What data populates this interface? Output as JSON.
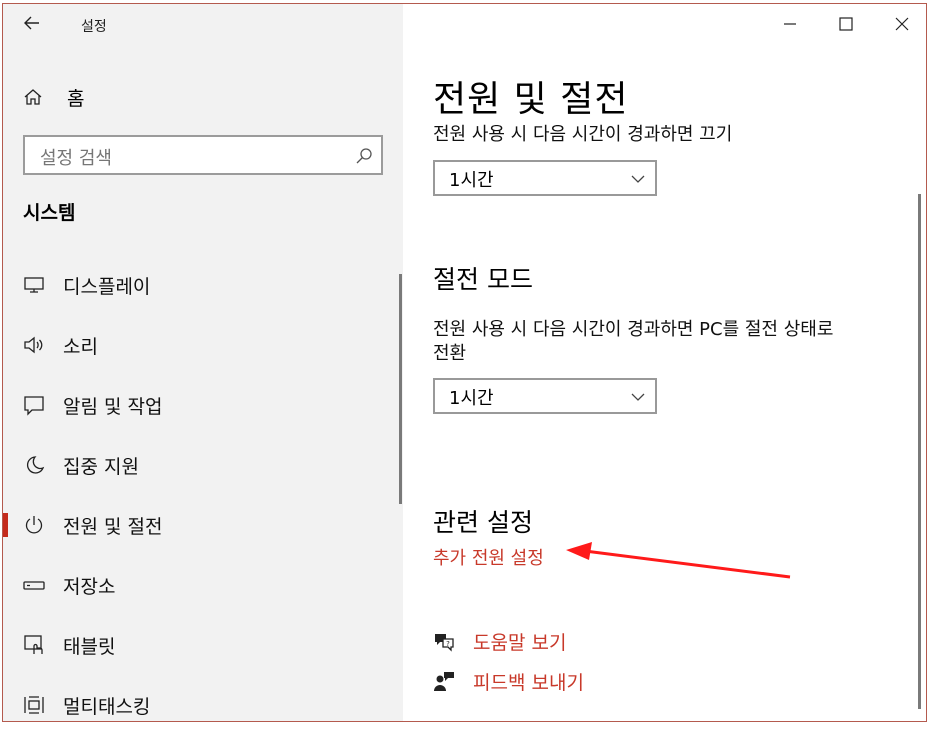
{
  "window": {
    "title": "설정",
    "back_icon": "back-arrow-icon",
    "controls": [
      "minimize-icon",
      "maximize-icon",
      "close-icon"
    ]
  },
  "sidebar": {
    "home_label": "홈",
    "search_placeholder": "설정 검색",
    "section_title": "시스템",
    "items": [
      {
        "label": "디스플레이",
        "icon": "display-icon"
      },
      {
        "label": "소리",
        "icon": "speaker-icon"
      },
      {
        "label": "알림 및 작업",
        "icon": "notification-icon"
      },
      {
        "label": "집중 지원",
        "icon": "moon-icon"
      },
      {
        "label": "전원 및 절전",
        "icon": "power-icon",
        "active": true
      },
      {
        "label": "저장소",
        "icon": "storage-icon"
      },
      {
        "label": "태블릿",
        "icon": "tablet-icon"
      },
      {
        "label": "멀티태스킹",
        "icon": "multitasking-icon"
      }
    ]
  },
  "main": {
    "title": "전원 및 절전",
    "screen_label": "전원 사용 시 다음 시간이 경과하면 끄기",
    "screen_value": "1시간",
    "sleep_title": "절전 모드",
    "sleep_label_line1": "전원 사용 시 다음 시간이 경과하면 PC를 절전 상태로",
    "sleep_label_line2": "전환",
    "sleep_value": "1시간",
    "related_title": "관련 설정",
    "related_link": "추가 전원 설정",
    "help_label": "도움말 보기",
    "feedback_label": "피드백 보내기"
  },
  "colors": {
    "accent": "#c8392a",
    "annotation_arrow": "#ff1a1a",
    "sidebar_bg": "#f2f2f2"
  }
}
